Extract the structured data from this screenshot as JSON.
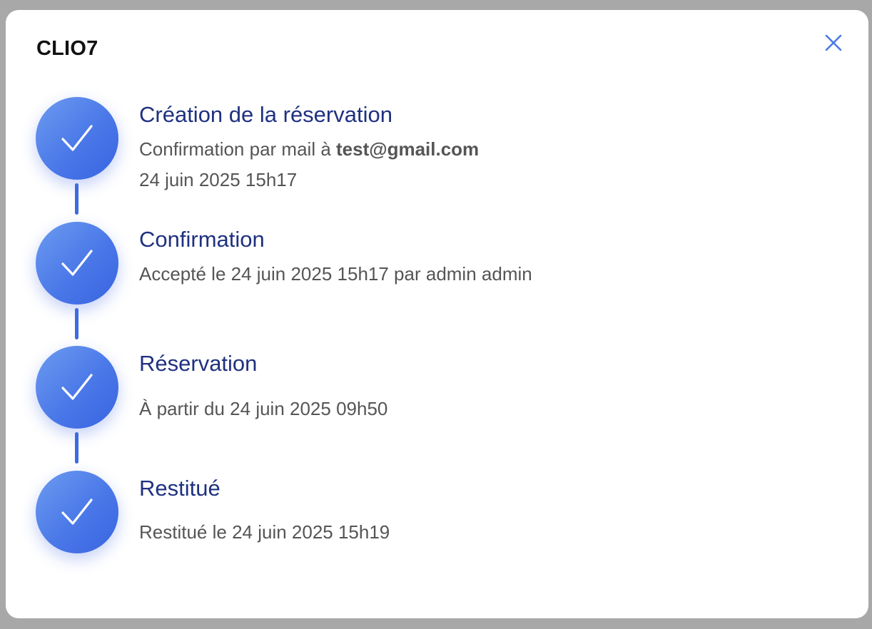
{
  "modal": {
    "title": "CLIO7",
    "close_icon": "close-icon"
  },
  "colors": {
    "step_gradient_start": "#6c9bf0",
    "step_gradient_end": "#3864e0",
    "step_title": "#1f3180",
    "close_icon": "#4a78e8",
    "connector": "#3d6be0"
  },
  "steps": [
    {
      "icon": "check-icon",
      "title": "Création de la réservation",
      "line1_prefix": "Confirmation par mail à ",
      "line1_email": "test@gmail.com",
      "line2": "24 juin 2025 15h17"
    },
    {
      "icon": "check-icon",
      "title": "Confirmation",
      "line1": "Accepté le 24 juin 2025 15h17 par admin admin"
    },
    {
      "icon": "check-icon",
      "title": "Réservation",
      "line1": "À partir du 24 juin 2025 09h50"
    },
    {
      "icon": "check-icon",
      "title": "Restitué",
      "line1": "Restitué le 24 juin 2025 15h19"
    }
  ]
}
